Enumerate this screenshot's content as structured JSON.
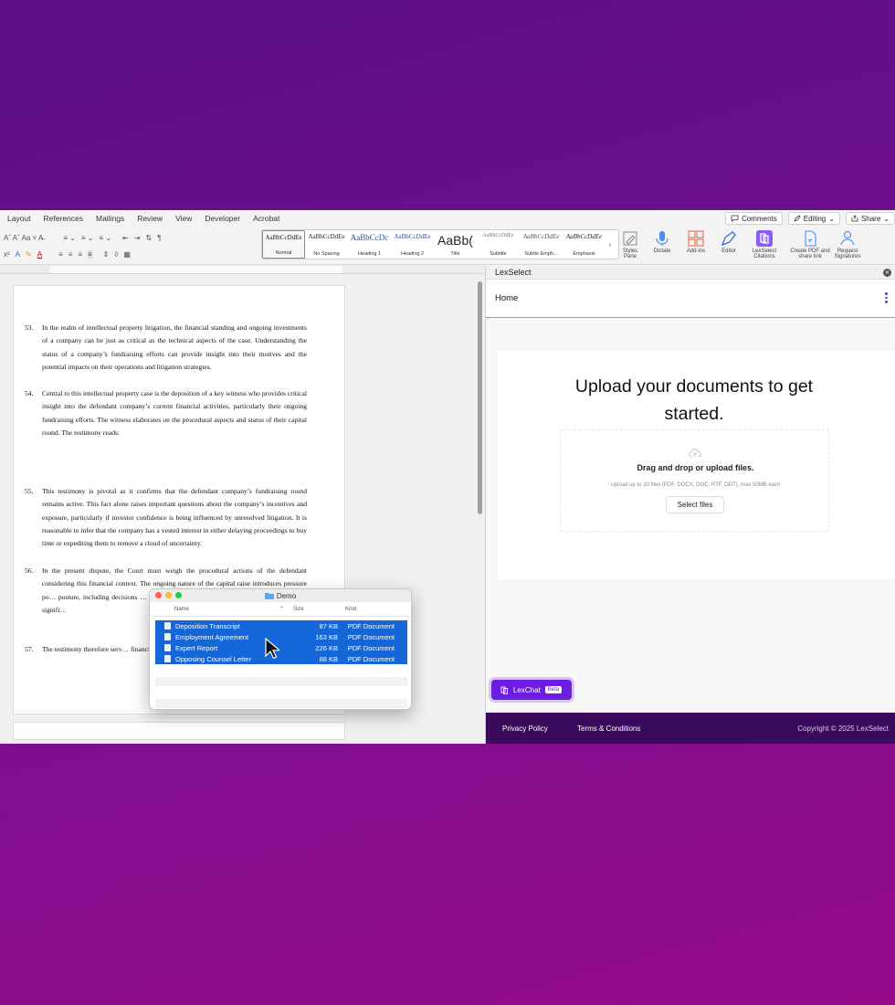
{
  "menu": {
    "tabs": [
      "Layout",
      "References",
      "Mailings",
      "Review",
      "View",
      "Developer",
      "Acrobat"
    ],
    "comments_label": "Comments",
    "editing_label": "Editing",
    "share_label": "Share"
  },
  "ribbon": {
    "font_size_row": "Aˆ  Aˇ   Aa ˅  A̶",
    "styles": [
      {
        "sample": "AaBbCcDdEe",
        "name": "Normal"
      },
      {
        "sample": "AaBbCcDdEe",
        "name": "No Spacing"
      },
      {
        "sample": "AaBbCcDc",
        "name": "Heading 1"
      },
      {
        "sample": "AaBbCcDdEe",
        "name": "Heading 2"
      },
      {
        "sample": "AaBb(",
        "name": "Title"
      },
      {
        "sample": "AaBbCcDdEe",
        "name": "Subtitle"
      },
      {
        "sample": "AaBbCcDdEe",
        "name": "Subtle Emph..."
      },
      {
        "sample": "AaBbCcDdEe",
        "name": "Emphasis"
      }
    ],
    "buttons": {
      "styles_pane": "Styles Pane",
      "dictate": "Dictate",
      "addins": "Add-ins",
      "editor": "Editor",
      "lexselect": "LexSelect Citations",
      "create_pdf": "Create PDF and share link",
      "request_sig": "Request Signatures"
    }
  },
  "document": {
    "paragraphs": [
      {
        "num": "53.",
        "text": "In the realm of intellectual property litigation, the financial standing and ongoing investments of a company can be just as critical as the technical aspects of the case. Understanding the status of a company’s fundraising efforts can provide insight into their motives and the potential impacts on their operations and litigation strategies."
      },
      {
        "num": "54.",
        "text": "Central to this intellectual property case is the deposition of a key witness who provides critical insight into the defendant company’s current financial activities, particularly their ongoing fundraising efforts. The witness elaborates on the procedural aspects and status of their capital round. The testimony reads:"
      },
      {
        "num": "55.",
        "text": "This testimony is pivotal as it confirms that the defendant company’s fundraising round remains active. This fact alone raises important questions about the company’s incentives and exposure, particularly if investor confidence is being influenced by unresolved litigation. It is reasonable to infer that the company has a vested interest in either delaying proceedings to buy time or expediting them to remove a cloud of uncertainty."
      },
      {
        "num": "56.",
        "text": "In the present dispute, the Court must weigh the procedural actions of the defendant considering this financial context. The ongoing nature of the capital raise introduces pressure po… posture, including decisions … for trial dates. These behavio… on a different strategic signifi…"
      },
      {
        "num": "57.",
        "text": "The testimony therefore serv… financial activities but as a le…"
      }
    ]
  },
  "finder": {
    "title": "Demo",
    "col_name": "Name",
    "col_size": "Size",
    "col_kind": "Kind",
    "files": [
      {
        "name": "Deposition Transcript",
        "size": "87 KB",
        "kind": "PDF Document"
      },
      {
        "name": "Employment Agreement",
        "size": "163 KB",
        "kind": "PDF Document"
      },
      {
        "name": "Expert Report",
        "size": "226 KB",
        "kind": "PDF Document"
      },
      {
        "name": "Opposing Counsel Letter",
        "size": "88 KB",
        "kind": "PDF Document"
      }
    ]
  },
  "lexselect": {
    "panel_title": "LexSelect",
    "nav_title": "Home",
    "upload_title": "Upload your documents to get started.",
    "drop_main": "Drag and drop or upload files.",
    "drop_sub": "Upload up to 10 files (PDF, DOCX, DOC, RTF, ODT), max 50MB each",
    "select_files": "Select files",
    "lexchat_label": "LexChat",
    "beta_label": "Beta",
    "footer": {
      "privacy": "Privacy Policy",
      "terms": "Terms & Conditions",
      "copyright": "Copyright © 2025 LexSelect"
    },
    "accent_color": "#6b1ee0"
  }
}
